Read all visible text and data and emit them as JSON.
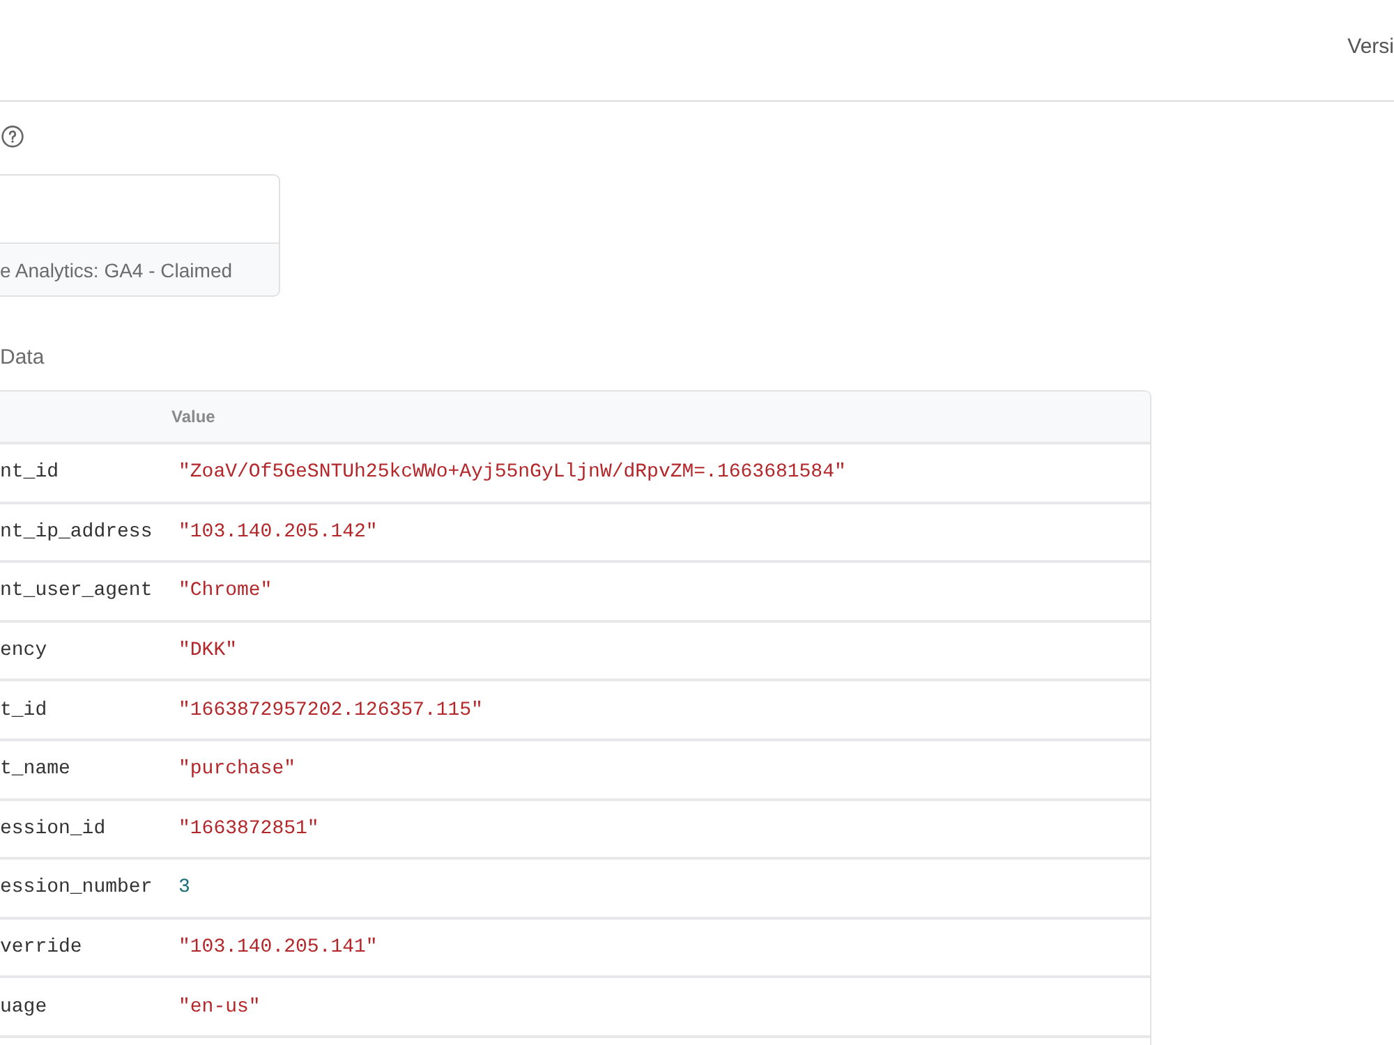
{
  "header": {
    "version_label": "Versi"
  },
  "tag_card": {
    "footer": "e Analytics: GA4 - Claimed"
  },
  "section": {
    "title": "Data"
  },
  "table": {
    "columns": [
      {
        "label": "Value"
      }
    ],
    "rows": [
      {
        "column_1": "nt_id",
        "value": "\"ZoaV/Of5GeSNTUh25kcWWo+Ayj55nGyLljnW/dRpvZM=.1663681584\"",
        "kind": "string"
      },
      {
        "column_1": "nt_ip_address",
        "value": "\"103.140.205.142\"",
        "kind": "string"
      },
      {
        "column_1": "nt_user_agent",
        "value": "\"Chrome\"",
        "kind": "string"
      },
      {
        "column_1": "ency",
        "value": "\"DKK\"",
        "kind": "string"
      },
      {
        "column_1": "t_id",
        "value": "\"1663872957202.126357.115\"",
        "kind": "string"
      },
      {
        "column_1": "t_name",
        "value": "\"purchase\"",
        "kind": "string"
      },
      {
        "column_1": "ession_id",
        "value": "\"1663872851\"",
        "kind": "string"
      },
      {
        "column_1": "ession_number",
        "value": "3",
        "kind": "number"
      },
      {
        "column_1": "verride",
        "value": "\"103.140.205.141\"",
        "kind": "string"
      },
      {
        "column_1": "uage",
        "value": "\"en-us\"",
        "kind": "string"
      }
    ]
  }
}
